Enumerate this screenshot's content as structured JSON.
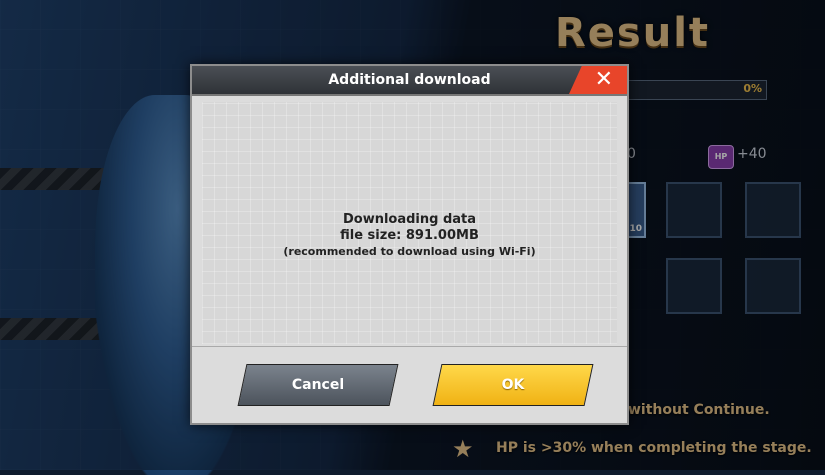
{
  "background": {
    "result_title": "Result",
    "progress_label": "0%",
    "progress_fraction": 0,
    "rewards": {
      "left_partial": "0",
      "hp_label": "+40"
    },
    "item_count": "10",
    "conditions": [
      {
        "text": "without Continue."
      },
      {
        "text": "HP is >30% when completing the stage."
      }
    ]
  },
  "dialog": {
    "title": "Additional download",
    "message_line1": "Downloading data",
    "message_line2": "file size: 891.00MB",
    "message_line3": "(recommended to download using Wi-Fi)",
    "cancel_label": "Cancel",
    "ok_label": "OK"
  },
  "colors": {
    "ok_button": "#f5c21f",
    "cancel_button": "#5d646d",
    "close_button": "#e8452a",
    "result_title": "#e7c48a"
  },
  "icons": [
    "close-icon",
    "star-icon",
    "hp-badge-icon"
  ]
}
